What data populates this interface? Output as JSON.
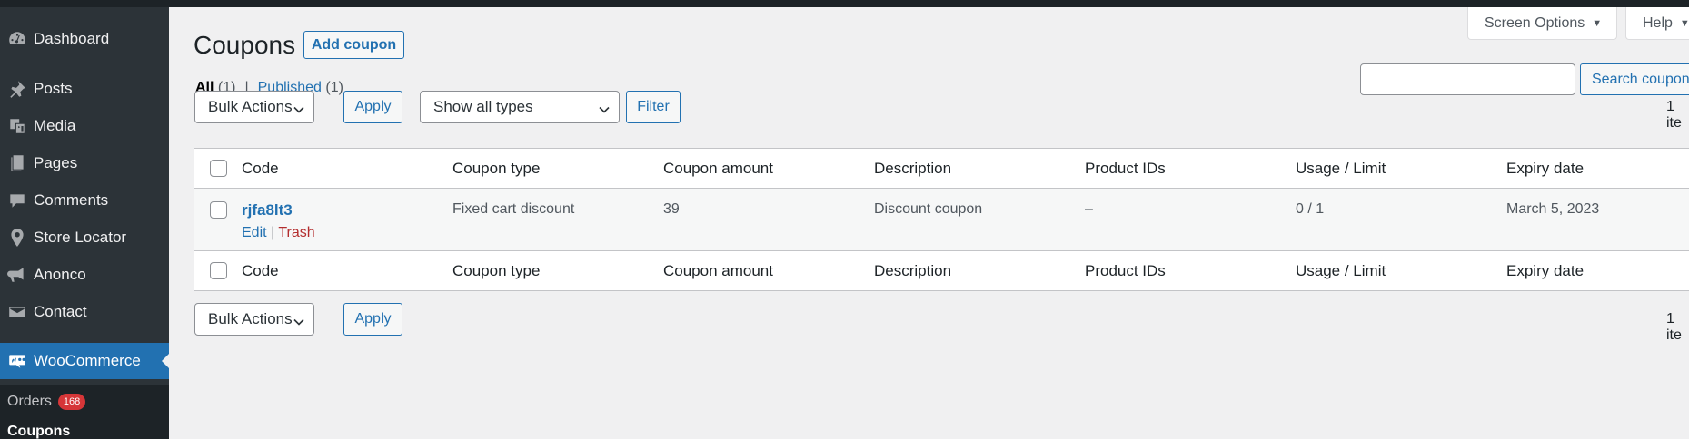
{
  "sidebar": {
    "items": [
      {
        "label": "Dashboard",
        "icon": "dashboard-icon"
      },
      {
        "label": "Posts",
        "icon": "pin-icon"
      },
      {
        "label": "Media",
        "icon": "media-icon"
      },
      {
        "label": "Pages",
        "icon": "pages-icon"
      },
      {
        "label": "Comments",
        "icon": "comment-icon"
      },
      {
        "label": "Store Locator",
        "icon": "location-pin-icon"
      },
      {
        "label": "Anonco",
        "icon": "megaphone-icon"
      },
      {
        "label": "Contact",
        "icon": "envelope-icon"
      },
      {
        "label": "WooCommerce",
        "icon": "woo-icon"
      }
    ],
    "submenu": {
      "orders_label": "Orders",
      "orders_count": "168",
      "coupons_label": "Coupons"
    }
  },
  "header": {
    "screen_options": "Screen Options",
    "help": "Help"
  },
  "page": {
    "title": "Coupons",
    "add_button": "Add coupon",
    "filters": {
      "all_label": "All",
      "all_count": "(1)",
      "separator": "|",
      "published_label": "Published",
      "published_count": "(1)"
    },
    "search_placeholder": "",
    "search_button": "Search coupons"
  },
  "tablenav_top": {
    "bulk_actions": "Bulk Actions",
    "apply": "Apply",
    "type_filter": "Show all types",
    "filter_button": "Filter",
    "count": "1 ite"
  },
  "table": {
    "columns": [
      "Code",
      "Coupon type",
      "Coupon amount",
      "Description",
      "Product IDs",
      "Usage / Limit",
      "Expiry date"
    ],
    "rows": [
      {
        "code": "rjfa8lt3",
        "type": "Fixed cart discount",
        "amount": "39",
        "description": "Discount coupon",
        "product_ids": "–",
        "usage": "0 / 1",
        "expiry": "March 5, 2023",
        "actions": {
          "edit": "Edit",
          "sep": "|",
          "trash": "Trash"
        }
      }
    ]
  },
  "tablenav_bottom": {
    "bulk_actions": "Bulk Actions",
    "apply": "Apply",
    "count": "1 ite"
  },
  "colors": {
    "accent": "#2271b1",
    "sidebar": "#2c3338",
    "active": "#2271b1",
    "badge": "#d63638",
    "trash": "#b32d2e"
  }
}
